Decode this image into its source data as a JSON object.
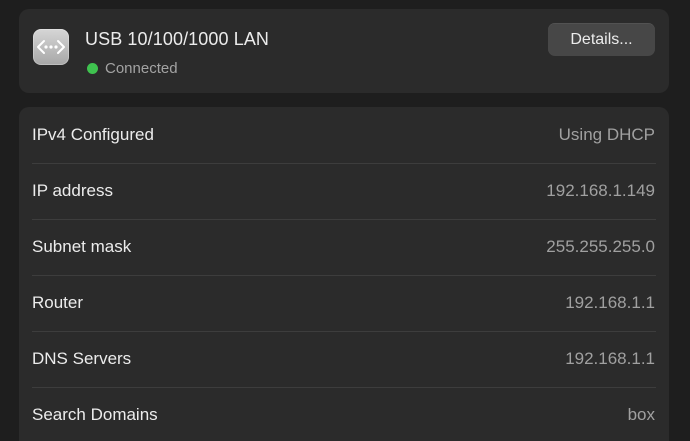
{
  "interface": {
    "icon": "ethernet-arrows-icon",
    "title": "USB 10/100/1000 LAN",
    "status": "Connected",
    "status_color": "#3fc24f",
    "details_label": "Details..."
  },
  "info": {
    "rows": [
      {
        "label": "IPv4 Configured",
        "value": "Using DHCP"
      },
      {
        "label": "IP address",
        "value": "192.168.1.149"
      },
      {
        "label": "Subnet mask",
        "value": "255.255.255.0"
      },
      {
        "label": "Router",
        "value": "192.168.1.1"
      },
      {
        "label": "DNS Servers",
        "value": "192.168.1.1"
      },
      {
        "label": "Search Domains",
        "value": "box"
      }
    ]
  }
}
